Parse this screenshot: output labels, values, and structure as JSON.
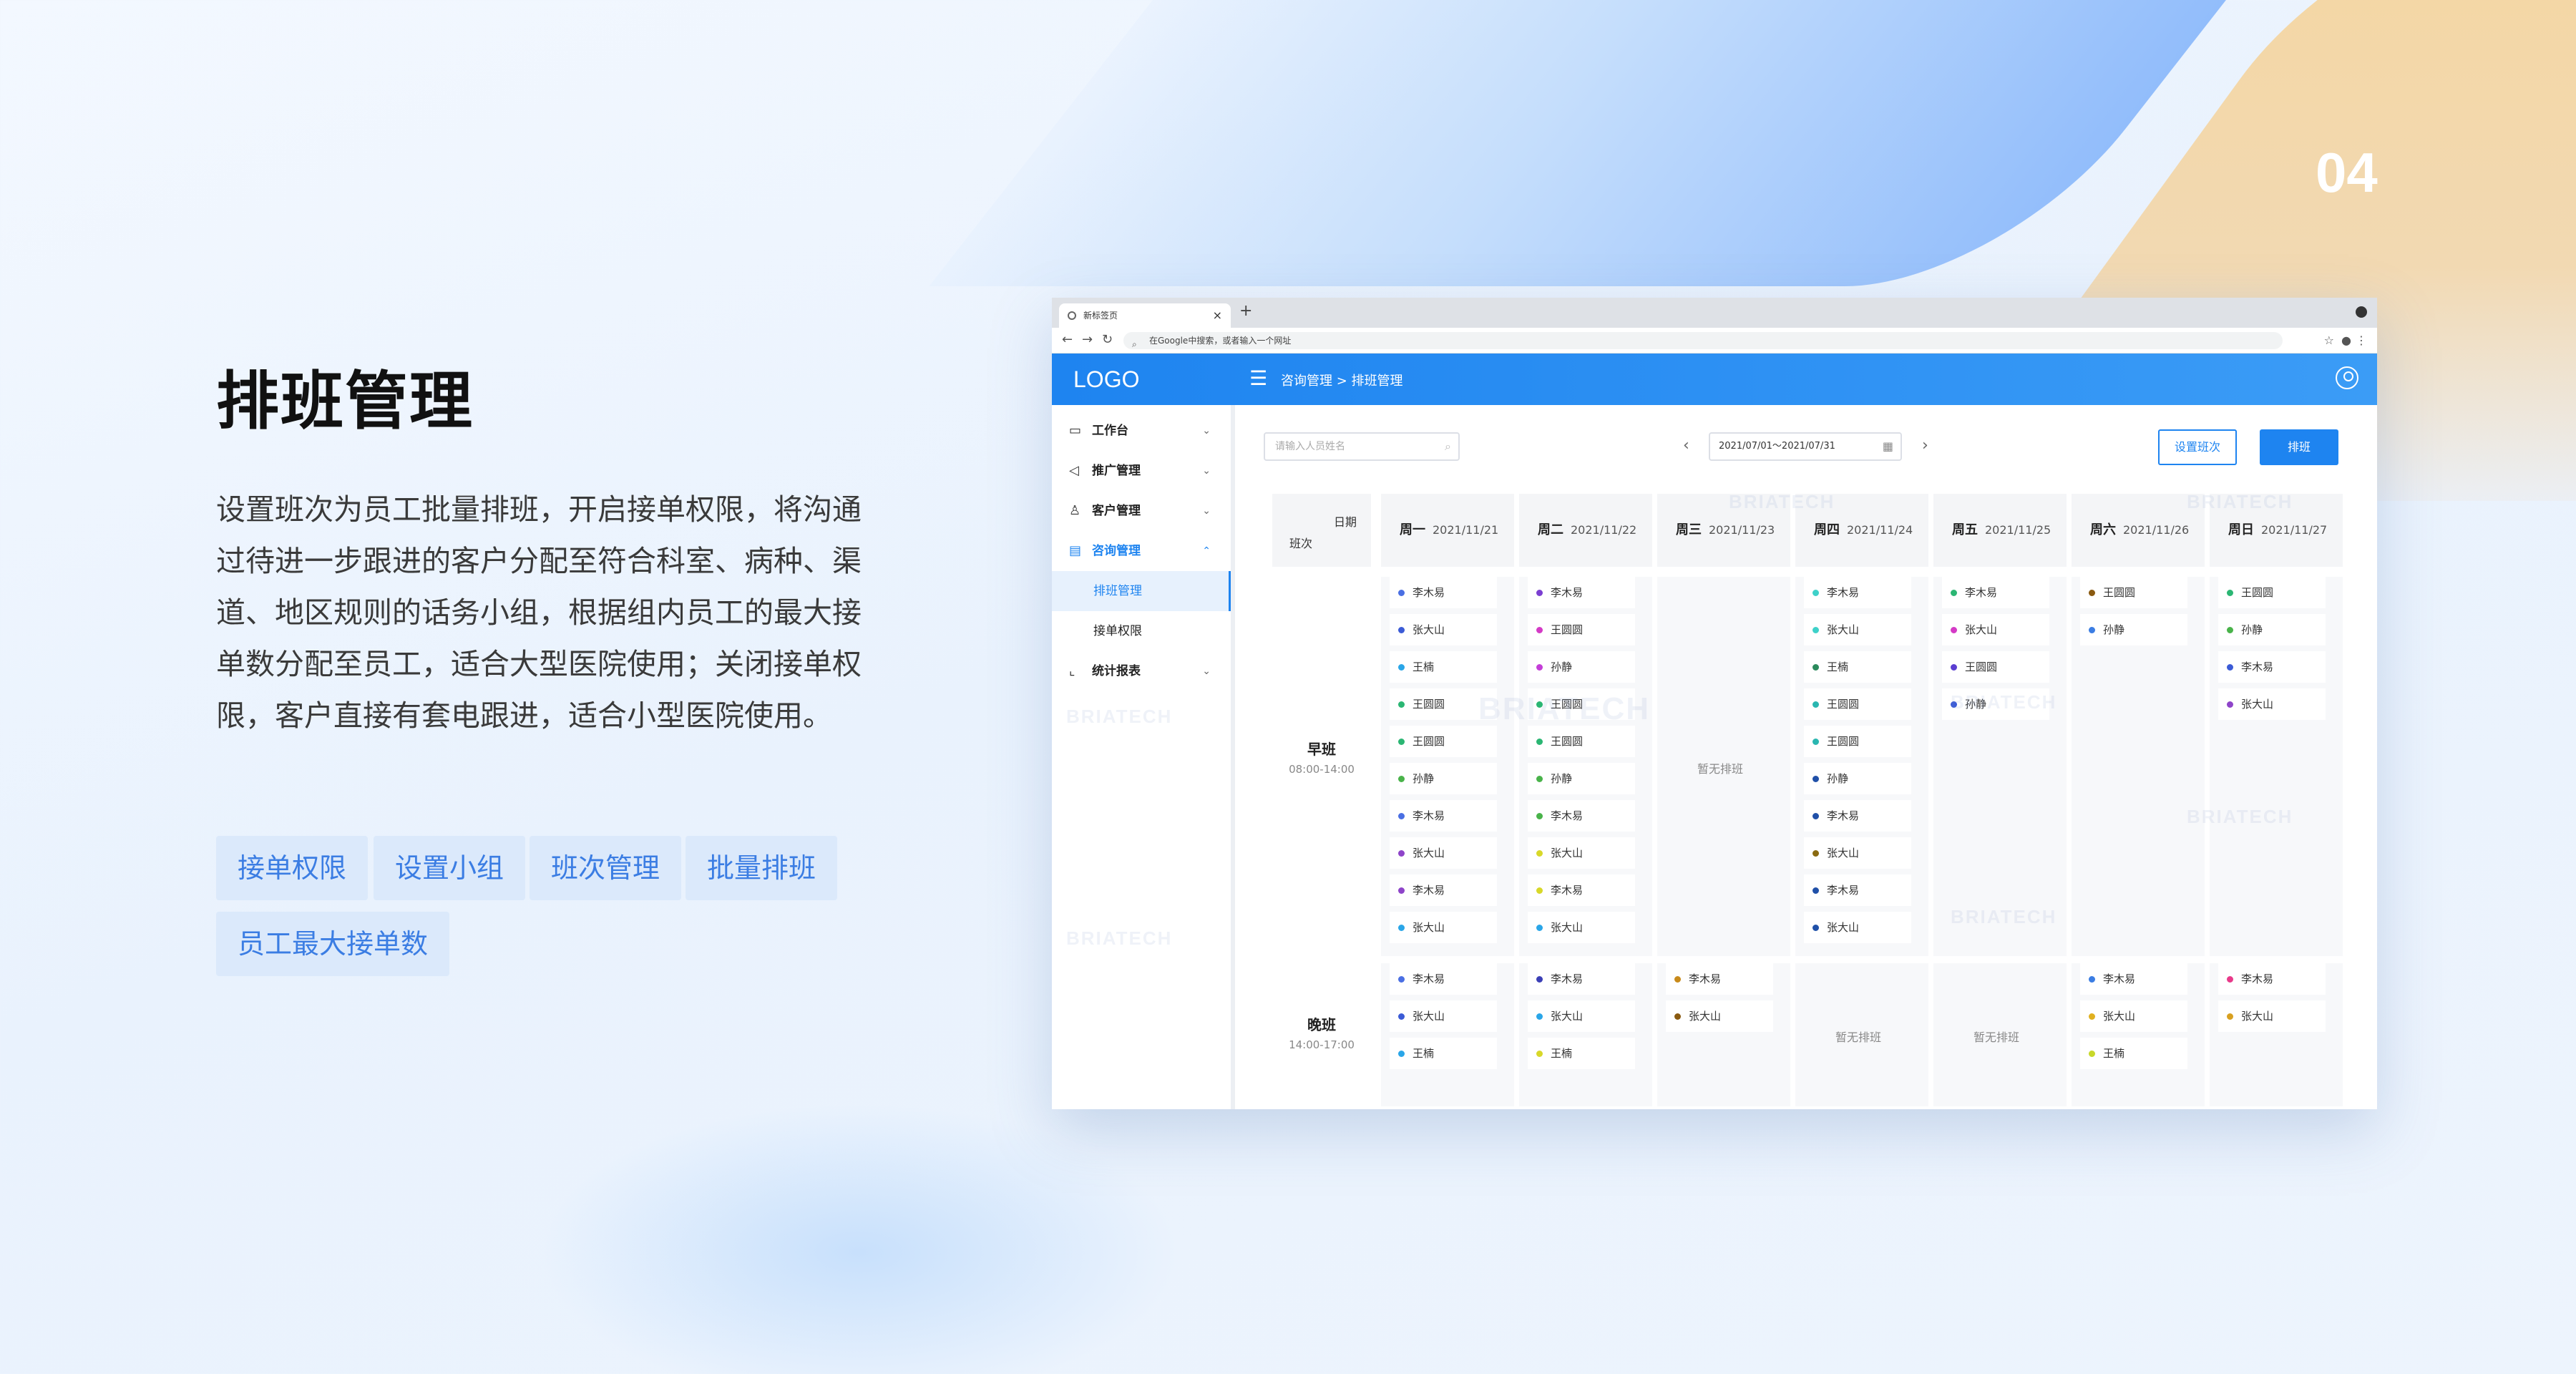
{
  "page_number": "04",
  "title": "排班管理",
  "description": "设置班次为员工批量排班，开启接单权限，将沟通过待进一步跟进的客户分配至符合科室、病种、渠道、地区规则的话务小组，根据组内员工的最大接单数分配至员工，适合大型医院使用；关闭接单权限，客户直接有套电跟进，适合小型医院使用。",
  "tags": [
    "接单权限",
    "设置小组",
    "班次管理",
    "批量排班",
    "员工最大接单数"
  ],
  "browser": {
    "tab_title": "新标签页",
    "address_placeholder": "在Google中搜索，或者输入一个网址"
  },
  "app": {
    "logo": "LOGO",
    "breadcrumb": "咨询管理 > 排班管理"
  },
  "sidebar": {
    "items": [
      {
        "label": "工作台",
        "icon": "monitor-icon"
      },
      {
        "label": "推广管理",
        "icon": "megaphone-icon"
      },
      {
        "label": "客户管理",
        "icon": "user-icon"
      },
      {
        "label": "咨询管理",
        "icon": "chat-icon"
      },
      {
        "label": "统计报表",
        "icon": "chart-icon"
      }
    ],
    "sub_items": [
      "排班管理",
      "接单权限"
    ]
  },
  "toolbar": {
    "search_placeholder": "请输入人员姓名",
    "date_range": "2021/07/01～2021/07/31",
    "set_shift_label": "设置班次",
    "schedule_label": "排班"
  },
  "table": {
    "corner_date": "日期",
    "corner_shift": "班次",
    "days": [
      {
        "day": "周一",
        "date": "2021/11/21"
      },
      {
        "day": "周二",
        "date": "2021/11/22"
      },
      {
        "day": "周三",
        "date": "2021/11/23"
      },
      {
        "day": "周四",
        "date": "2021/11/24"
      },
      {
        "day": "周五",
        "date": "2021/11/25"
      },
      {
        "day": "周六",
        "date": "2021/11/26"
      },
      {
        "day": "周日",
        "date": "2021/11/27"
      }
    ],
    "no_schedule": "暂无排班",
    "shifts": [
      {
        "name": "早班",
        "time": "08:00-14:00",
        "cells": [
          [
            [
              "李木易",
              "#4a6fe3"
            ],
            [
              "张大山",
              "#3b5bd6"
            ],
            [
              "王楠",
              "#2aa6e8"
            ],
            [
              "王圆圆",
              "#2bb673"
            ],
            [
              "王圆圆",
              "#2bb673"
            ],
            [
              "孙静",
              "#49b34a"
            ],
            [
              "李木易",
              "#4a6fe3"
            ],
            [
              "张大山",
              "#8e44c9"
            ],
            [
              "李木易",
              "#8e44c9"
            ],
            [
              "张大山",
              "#2aa6e8"
            ]
          ],
          [
            [
              "李木易",
              "#7b3fd1"
            ],
            [
              "王圆圆",
              "#d43ac6"
            ],
            [
              "孙静",
              "#c43ed8"
            ],
            [
              "王圆圆",
              "#2bb673"
            ],
            [
              "王圆圆",
              "#2bb673"
            ],
            [
              "孙静",
              "#49b34a"
            ],
            [
              "李木易",
              "#49b34a"
            ],
            [
              "张大山",
              "#d8d829"
            ],
            [
              "李木易",
              "#d8d829"
            ],
            [
              "张大山",
              "#2aa6e8"
            ]
          ],
          [],
          [
            [
              "李木易",
              "#3ed1c9"
            ],
            [
              "张大山",
              "#3ed1c9"
            ],
            [
              "王楠",
              "#2b8a5c"
            ],
            [
              "王圆圆",
              "#2ab6b0"
            ],
            [
              "王圆圆",
              "#2ab6b0"
            ],
            [
              "孙静",
              "#2050a8"
            ],
            [
              "李木易",
              "#2050a8"
            ],
            [
              "张大山",
              "#8a6a10"
            ],
            [
              "李木易",
              "#2050a8"
            ],
            [
              "张大山",
              "#2050a8"
            ]
          ],
          [
            [
              "李木易",
              "#2bb673"
            ],
            [
              "张大山",
              "#d43ac6"
            ],
            [
              "王圆圆",
              "#5b3ed1"
            ],
            [
              "孙静",
              "#3b5bd6"
            ]
          ],
          [
            [
              "王圆圆",
              "#8a5a10"
            ],
            [
              "孙静",
              "#3b7de3"
            ]
          ],
          [
            [
              "王圆圆",
              "#2bb673"
            ],
            [
              "孙静",
              "#49b34a"
            ],
            [
              "李木易",
              "#3b5bd6"
            ],
            [
              "张大山",
              "#8e44c9"
            ]
          ]
        ]
      },
      {
        "name": "晚班",
        "time": "14:00-17:00",
        "cells": [
          [
            [
              "李木易",
              "#4a6fe3"
            ],
            [
              "张大山",
              "#3b5bd6"
            ],
            [
              "王楠",
              "#2aa6e8"
            ]
          ],
          [
            [
              "李木易",
              "#3b3fb6"
            ],
            [
              "张大山",
              "#2aa6e8"
            ],
            [
              "王楠",
              "#d8d829"
            ]
          ],
          [
            [
              "李木易",
              "#c88a1a"
            ],
            [
              "张大山",
              "#8a5a10"
            ]
          ],
          [],
          [],
          [
            [
              "李木易",
              "#3b7de3"
            ],
            [
              "张大山",
              "#e0b020"
            ],
            [
              "王楠",
              "#c8d829"
            ]
          ],
          [
            [
              "李木易",
              "#e83a8a"
            ],
            [
              "张大山",
              "#d8a020"
            ]
          ]
        ]
      }
    ]
  },
  "watermark": "BRIATECH",
  "colors": {
    "accent": "#1e84f0",
    "tag_bg": "#dbe9fb",
    "tag_text": "#3b7de3",
    "page_number": "#ffffff"
  }
}
